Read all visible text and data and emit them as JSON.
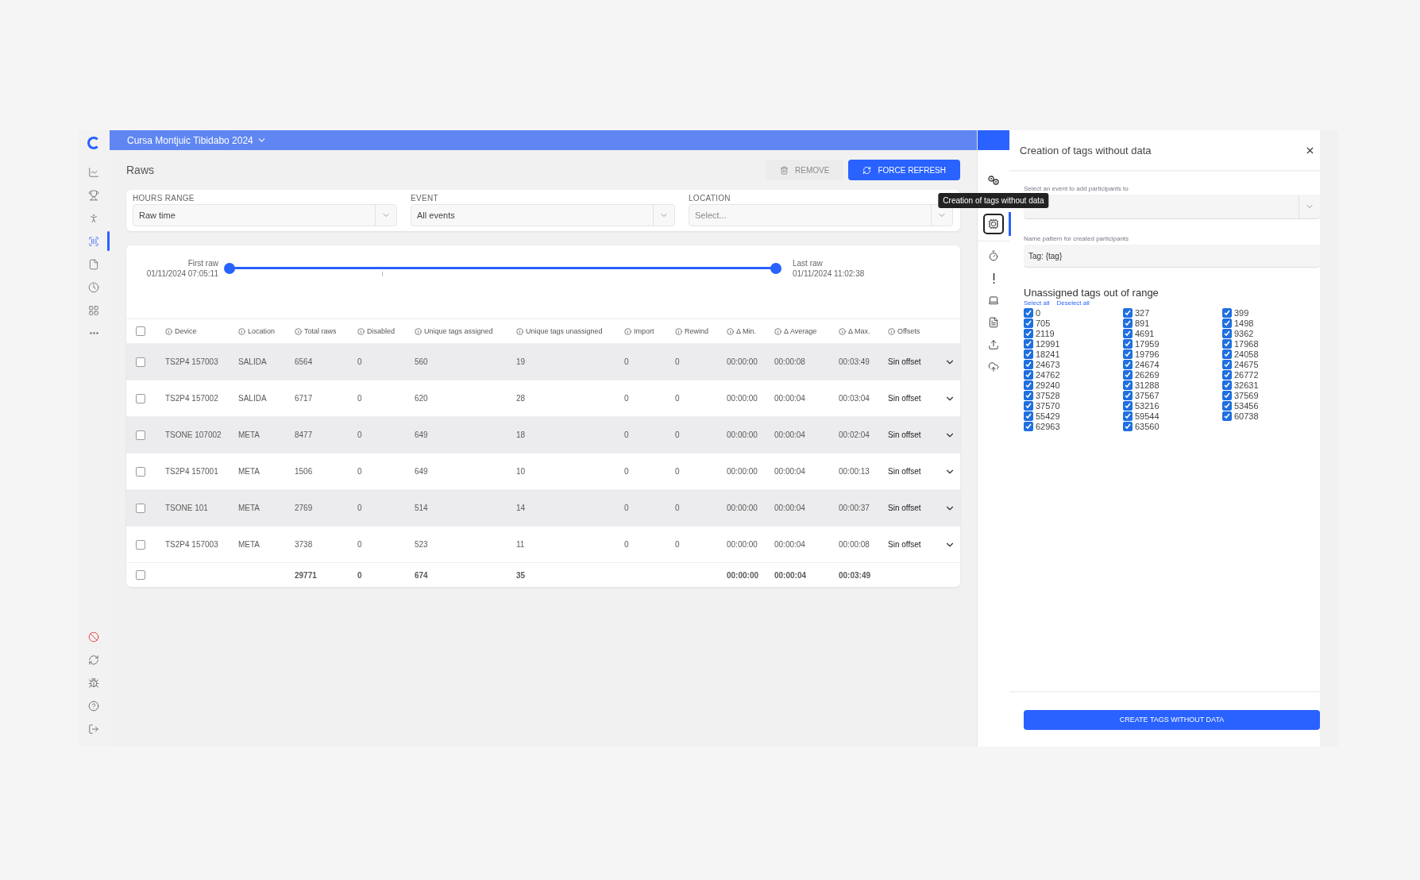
{
  "header": {
    "event_title": "Cursa Montjuic Tibidabo 2024"
  },
  "sidebar": {
    "top_items": [
      {
        "selected": false
      },
      {
        "selected": false
      },
      {
        "selected": false
      },
      {
        "selected": true
      },
      {
        "selected": false
      },
      {
        "selected": false
      },
      {
        "selected": false
      },
      {
        "selected": false
      }
    ]
  },
  "page": {
    "title": "Raws",
    "buttons": [
      {
        "label": "REMOVE",
        "disabled": true
      },
      {
        "label": "FORCE REFRESH",
        "disabled": false
      }
    ]
  },
  "filters": [
    {
      "label": "HOURS RANGE",
      "value": "Raw time"
    },
    {
      "label": "EVENT",
      "value": "All events"
    },
    {
      "label": "LOCATION",
      "placeholder": "Select..."
    }
  ],
  "range": {
    "level": 1,
    "start_label": "First raw",
    "start_time": "01/11/2024 07:05:11",
    "end_label": "Last raw",
    "end_time": "01/11/2024 11:02:38"
  },
  "table": {
    "all_checked": false,
    "columns": [
      "Device",
      "Location",
      "Total raws",
      "Disabled",
      "Unique tags assigned",
      "Unique tags unassigned",
      "Import",
      "Rewind",
      "Δ Min.",
      "Δ Average",
      "Δ Max.",
      "Offsets"
    ],
    "rows": [
      {
        "checked": false,
        "cells": [
          "TS2P4 157003",
          "SALIDA",
          "6564",
          "0",
          "560",
          "19",
          "0",
          "0",
          "00:00:00",
          "00:00:08",
          "00:03:49",
          "Sin offset"
        ]
      },
      {
        "checked": false,
        "cells": [
          "TS2P4 157002",
          "SALIDA",
          "6717",
          "0",
          "620",
          "28",
          "0",
          "0",
          "00:00:00",
          "00:00:04",
          "00:03:04",
          "Sin offset"
        ]
      },
      {
        "checked": false,
        "cells": [
          "TSONE 107002",
          "META",
          "8477",
          "0",
          "649",
          "18",
          "0",
          "0",
          "00:00:00",
          "00:00:04",
          "00:02:04",
          "Sin offset"
        ]
      },
      {
        "checked": false,
        "cells": [
          "TS2P4 157001",
          "META",
          "1506",
          "0",
          "649",
          "10",
          "0",
          "0",
          "00:00:00",
          "00:00:04",
          "00:00:13",
          "Sin offset"
        ]
      },
      {
        "checked": false,
        "cells": [
          "TSONE 101",
          "META",
          "2769",
          "0",
          "514",
          "14",
          "0",
          "0",
          "00:00:00",
          "00:00:04",
          "00:00:37",
          "Sin offset"
        ]
      },
      {
        "checked": false,
        "cells": [
          "TS2P4 157003",
          "META",
          "3738",
          "0",
          "523",
          "11",
          "0",
          "0",
          "00:00:00",
          "00:00:04",
          "00:00:08",
          "Sin offset"
        ]
      }
    ],
    "totals": {
      "checked": false,
      "cells": [
        "",
        "",
        "29771",
        "0",
        "674",
        "35",
        "",
        "",
        "00:00:00",
        "00:00:04",
        "00:03:49",
        ""
      ]
    }
  },
  "tool_rail": {
    "items": [
      {
        "selected": false
      },
      {
        "selected": true
      },
      {
        "selected": false
      },
      {
        "selected": false
      },
      {
        "selected": false
      },
      {
        "selected": false
      },
      {
        "selected": false
      },
      {
        "selected": false
      }
    ],
    "tooltip": "Creation of tags without data"
  },
  "panel": {
    "title": "Creation of tags without data",
    "event_field": {
      "label": "Select an event to add participants to"
    },
    "pattern_field": {
      "label": "Name pattern for created participants",
      "value": "Tag: {tag}"
    },
    "tags_heading": "Unassigned tags out of range",
    "select_all": "Select all",
    "deselect_all": "Deselect all",
    "tags": [
      {
        "label": "0",
        "checked": true
      },
      {
        "label": "327",
        "checked": true
      },
      {
        "label": "399",
        "checked": true
      },
      {
        "label": "705",
        "checked": true
      },
      {
        "label": "891",
        "checked": true
      },
      {
        "label": "1498",
        "checked": true
      },
      {
        "label": "2119",
        "checked": true
      },
      {
        "label": "4691",
        "checked": true
      },
      {
        "label": "9362",
        "checked": true
      },
      {
        "label": "12991",
        "checked": true
      },
      {
        "label": "17959",
        "checked": true
      },
      {
        "label": "17968",
        "checked": true
      },
      {
        "label": "18241",
        "checked": true
      },
      {
        "label": "19796",
        "checked": true
      },
      {
        "label": "24058",
        "checked": true
      },
      {
        "label": "24673",
        "checked": true
      },
      {
        "label": "24674",
        "checked": true
      },
      {
        "label": "24675",
        "checked": true
      },
      {
        "label": "24762",
        "checked": true
      },
      {
        "label": "26269",
        "checked": true
      },
      {
        "label": "26772",
        "checked": true
      },
      {
        "label": "29240",
        "checked": true
      },
      {
        "label": "31288",
        "checked": true
      },
      {
        "label": "32631",
        "checked": true
      },
      {
        "label": "37528",
        "checked": true
      },
      {
        "label": "37567",
        "checked": true
      },
      {
        "label": "37569",
        "checked": true
      },
      {
        "label": "37570",
        "checked": true
      },
      {
        "label": "53216",
        "checked": true
      },
      {
        "label": "53456",
        "checked": true
      },
      {
        "label": "55429",
        "checked": true
      },
      {
        "label": "59544",
        "checked": true
      },
      {
        "label": "60738",
        "checked": true
      },
      {
        "label": "62963",
        "checked": true
      },
      {
        "label": "63560",
        "checked": true
      }
    ],
    "submit": "CREATE TAGS WITHOUT DATA"
  }
}
